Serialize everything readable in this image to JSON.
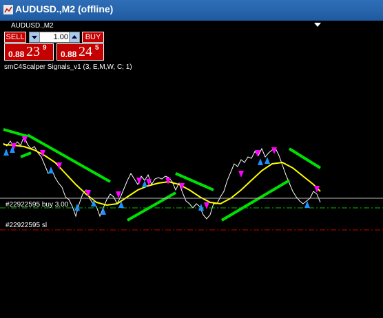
{
  "window": {
    "title": "AUDUSD.,M2 (offline)"
  },
  "chart_header": {
    "label": "AUDUSD.,M2"
  },
  "trade_panel": {
    "sell_label": "SELL",
    "buy_label": "BUY",
    "lot_value": "1.00",
    "sell_price": {
      "small": "0.88",
      "big": "23",
      "sup": "9"
    },
    "buy_price": {
      "small": "0.88",
      "big": "24",
      "sup": "5"
    }
  },
  "indicator_label": "smC4Scalper Signals_v1 (3, E,M,W, C; 1)",
  "order_lines": {
    "buy_line_label": "#22922595 buy 3.00",
    "sl_line_label": "#22922595 sl"
  },
  "colors": {
    "bg": "#000000",
    "yellow_ma": "#ffff00",
    "green_band": "#00e000",
    "sell_arrow": "#ff00ff",
    "buy_arrow": "#1e90ff",
    "price_line": "#ffffff",
    "buy_line": "#00c000",
    "sl_line": "#cc0000"
  }
}
